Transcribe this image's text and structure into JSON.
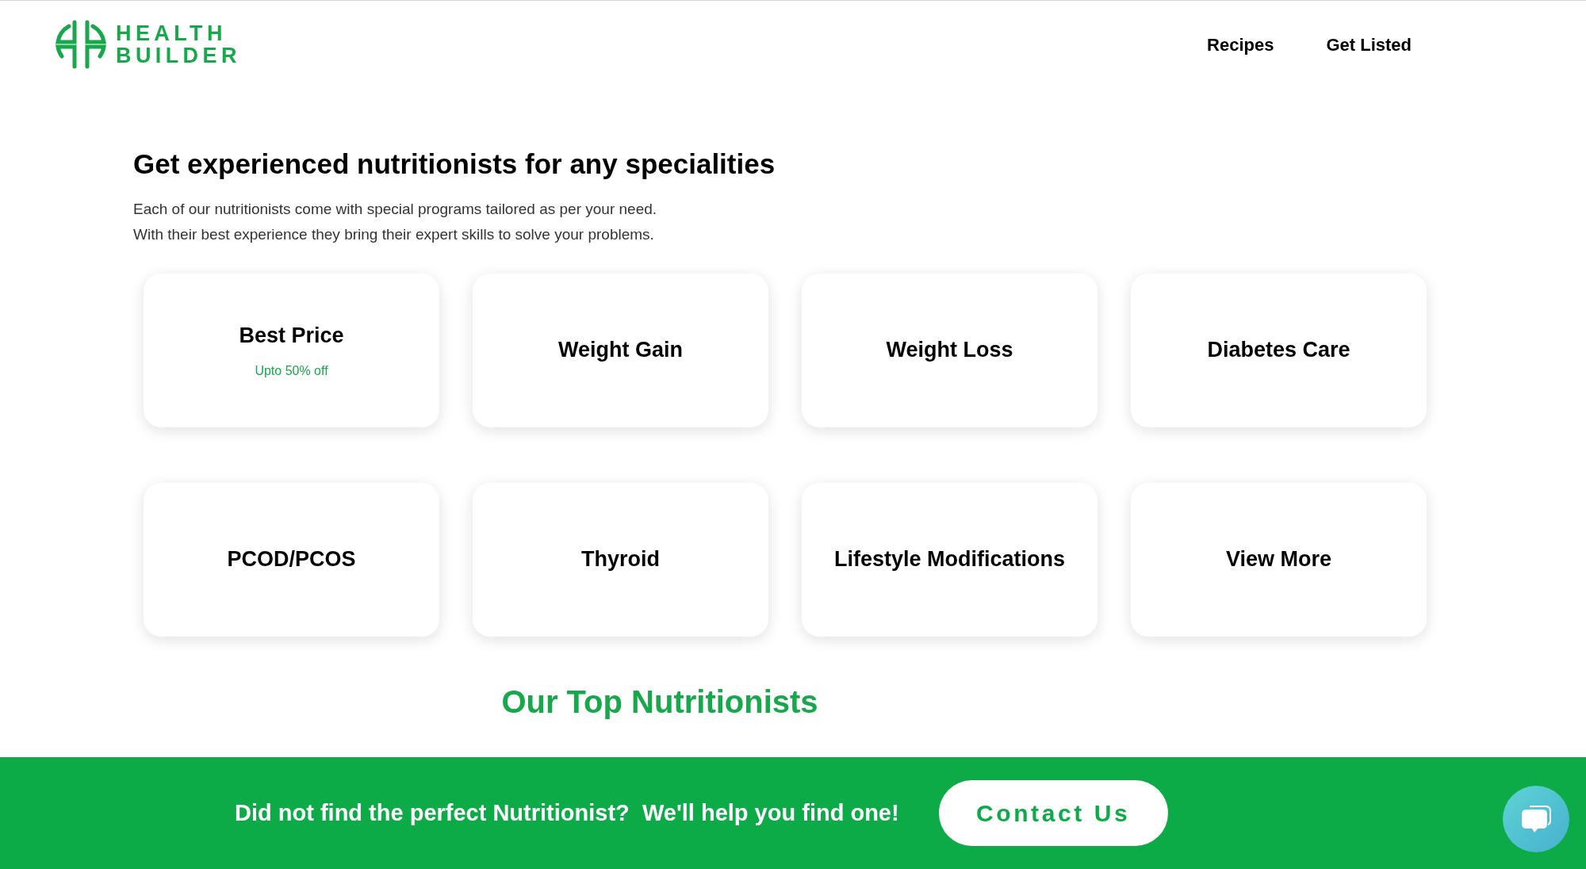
{
  "header": {
    "logo_text": [
      "HEALTH",
      "BUILDER"
    ],
    "nav": [
      "Recipes",
      "Get Listed"
    ]
  },
  "intro": {
    "title": "Get experienced nutritionists for any specialities",
    "lines": [
      "Each of our nutritionists come with special programs tailored as per your need.",
      "With their best experience they bring their expert skills to solve your problems."
    ]
  },
  "specialities": [
    {
      "title": "Best Price",
      "subtitle": "Upto 50% off"
    },
    {
      "title": "Weight Gain"
    },
    {
      "title": "Weight Loss"
    },
    {
      "title": "Diabetes Care"
    },
    {
      "title": "PCOD/PCOS"
    },
    {
      "title": "Thyroid"
    },
    {
      "title": "Lifestyle Modifications"
    },
    {
      "title": "View More"
    }
  ],
  "next_section": {
    "title": "Our Top Nutritionists"
  },
  "contact_bar": {
    "text": "Did not find the perfect Nutritionist?  We'll help you find one!",
    "button": "Contact Us"
  }
}
